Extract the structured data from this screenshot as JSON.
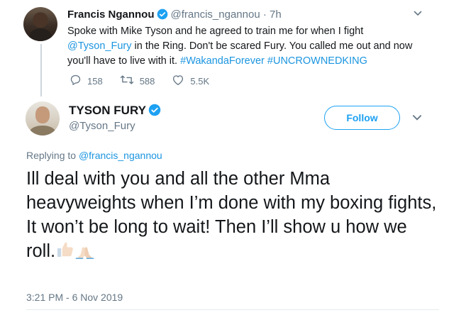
{
  "tweet1": {
    "name": "Francis Ngannou",
    "handle": "@francis_ngannou",
    "separator": "·",
    "time": "7h",
    "text_1": "Spoke with Mike Tyson and he agreed to train me for when I fight ",
    "mention": "@Tyson_Fury",
    "text_2": " in the Ring. Don't be scared Fury. You called me out and now you'll have to live with it. ",
    "hashtag_1": "#WakandaForever",
    "hashtag_2": "#UNCROWNEDKING",
    "replies": "158",
    "retweets": "588",
    "likes": "5.5K"
  },
  "tweet2": {
    "name": "TYSON FURY",
    "handle": "@Tyson_Fury",
    "follow_label": "Follow",
    "replying_prefix": "Replying to ",
    "replying_to": "@francis_ngannou",
    "text_line_1": "Ill deal with you and all the other Mma heavyweights when I’m done with my boxing fights,",
    "text_line_2": "It won’t be long to wait! Then I’ll show u how we roll.",
    "timestamp": "3:21 PM - 6 Nov 2019"
  },
  "icons": {
    "verified": "verified-badge-icon",
    "reply": "reply-icon",
    "retweet": "retweet-icon",
    "like": "heart-icon",
    "caret": "chevron-down-icon",
    "emoji_1": "thumbs-up-emoji",
    "emoji_2": "folded-hands-emoji"
  },
  "colors": {
    "link": "#1b95e0",
    "accent": "#1da1f2",
    "secondary_text": "#657786",
    "thread_line": "#ccd6dd"
  }
}
